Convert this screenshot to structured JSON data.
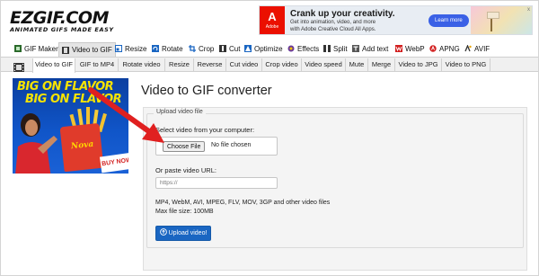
{
  "logo": {
    "name": "EZGIF.COM",
    "tagline": "ANIMATED GIFS MADE EASY"
  },
  "ad": {
    "brand_letter": "A",
    "brand_name": "Adobe",
    "title": "Crank up your creativity.",
    "line1": "Get into animation, video, and more",
    "line2": "with Adobe Creative Cloud All Apps.",
    "button": "Learn more",
    "close": "x"
  },
  "nav_primary": [
    {
      "label": "GIF Maker",
      "icon": "gif-maker-icon",
      "color": "#2b6a2b"
    },
    {
      "label": "Video to GIF",
      "icon": "film-icon",
      "color": "#333333",
      "active": true
    },
    {
      "label": "Resize",
      "icon": "resize-icon",
      "color": "#1a66c2"
    },
    {
      "label": "Rotate",
      "icon": "rotate-icon",
      "color": "#1a66c2"
    },
    {
      "label": "Crop",
      "icon": "crop-icon",
      "color": "#1a66c2"
    },
    {
      "label": "Cut",
      "icon": "scissors-icon",
      "color": "#333333"
    },
    {
      "label": "Optimize",
      "icon": "optimize-icon",
      "color": "#1a66c2"
    },
    {
      "label": "Effects",
      "icon": "effects-icon",
      "color": "#6a3a9a"
    },
    {
      "label": "Split",
      "icon": "split-icon",
      "color": "#333333"
    },
    {
      "label": "Add text",
      "icon": "text-icon",
      "color": "#333333"
    },
    {
      "label": "WebP",
      "icon": "webp-icon",
      "color": "#d21f1f"
    },
    {
      "label": "APNG",
      "icon": "apng-icon",
      "color": "#d21f1f"
    },
    {
      "label": "AVIF",
      "icon": "avif-icon",
      "color": "#333333"
    }
  ],
  "nav_secondary": [
    {
      "label": "Video to GIF",
      "active": true
    },
    {
      "label": "GIF to MP4"
    },
    {
      "label": "Rotate video"
    },
    {
      "label": "Resize"
    },
    {
      "label": "Reverse"
    },
    {
      "label": "Cut video"
    },
    {
      "label": "Crop video"
    },
    {
      "label": "Video speed"
    },
    {
      "label": "Mute"
    },
    {
      "label": "Merge"
    },
    {
      "label": "Video to JPG"
    },
    {
      "label": "Video to PNG"
    }
  ],
  "promo": {
    "headline1": "BIG ON FLAVOR",
    "headline2": "BIG ON FLAVOR",
    "product": "Nova",
    "cta": "BUY NOW"
  },
  "main": {
    "title": "Video to GIF converter",
    "legend": "Upload video file",
    "select_label": "Select video from your computer:",
    "file_button": "Choose File",
    "file_status": "No file chosen",
    "url_label": "Or paste video URL:",
    "url_placeholder": "https://",
    "formats_note": "MP4, WebM, AVI, MPEG, FLV, MOV, 3GP and other video files",
    "max_size": "Max file size: 100MB",
    "upload_button": "Upload video!"
  },
  "colors": {
    "accent_blue": "#1a66c2",
    "annotation_red": "#e02020",
    "promo_blue": "#0b3fa0",
    "promo_yellow": "#f6e300",
    "ad_button": "#3a61e6",
    "adobe_red": "#eb1000"
  }
}
